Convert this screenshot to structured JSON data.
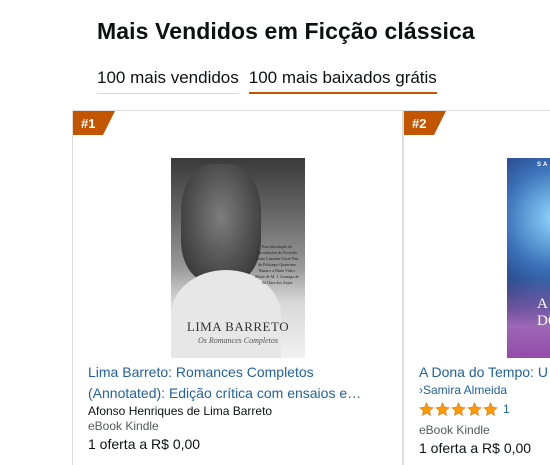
{
  "page": {
    "title": "Mais Vendidos em Ficção clássica"
  },
  "tabs": [
    {
      "label": "100 mais vendidos",
      "active": false
    },
    {
      "label": "100 mais baixados grátis",
      "active": true
    }
  ],
  "colors": {
    "badge": "#c45500",
    "link": "#2162a1",
    "star": "#ff9900"
  },
  "products": [
    {
      "rank": "#1",
      "cover": {
        "author": "LIMA BARRETO",
        "subtitle": "Os Romances Completos",
        "blurb": "Esta Introdução de Recordações do Escrivão Isaías Caminha Triste Fim de Policarpo Quaresma Numa e a Ninfa Vida e Morte de M. J. Gonzaga de Sá Clara dos Anjos"
      },
      "title_line1": "Lima Barreto: Romances Completos",
      "title_line2": "(Annotated): Edição crítica com ensaios e…",
      "author": "Afonso Henriques de Lima Barreto",
      "format": "eBook Kindle",
      "offer": "1 oferta a R$ 0,00"
    },
    {
      "rank": "#2",
      "cover": {
        "top_text": "SA",
        "title_line1": "A",
        "title_line2": "DO"
      },
      "title": "A Dona do Tempo: U",
      "author": "Samira Almeida",
      "author_prefix": "›",
      "rating": 5,
      "rating_count": "1",
      "format": "eBook Kindle",
      "offer": "1 oferta a R$ 0,00"
    }
  ]
}
